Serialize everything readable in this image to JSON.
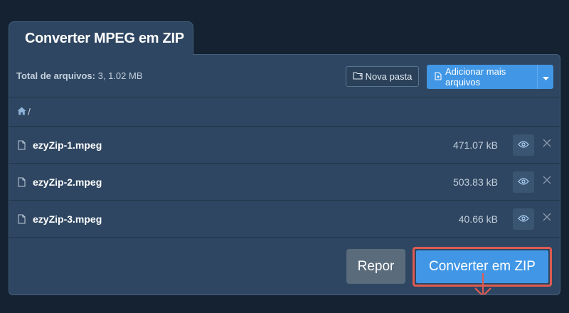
{
  "tab": {
    "title": "Converter MPEG em ZIP"
  },
  "toolbar": {
    "total_label": "Total de arquivos:",
    "total_value": "3, 1.02 MB",
    "new_folder_label": "Nova pasta",
    "add_files_label": "Adicionar mais arquivos"
  },
  "breadcrumb": {
    "root_separator": "/"
  },
  "files": [
    {
      "name": "ezyZip-1.mpeg",
      "size": "471.07 kB"
    },
    {
      "name": "ezyZip-2.mpeg",
      "size": "503.83 kB"
    },
    {
      "name": "ezyZip-3.mpeg",
      "size": "40.66 kB"
    }
  ],
  "actions": {
    "reset_label": "Repor",
    "convert_label": "Converter em ZIP"
  },
  "colors": {
    "background": "#152232",
    "panel": "#2e4661",
    "primary": "#4197e6",
    "reset": "#5a6b7b",
    "highlight": "#de5b52"
  },
  "icons": {
    "home": "home-icon",
    "file": "file-icon",
    "eye": "eye-icon",
    "close": "close-icon",
    "folder": "folder-icon",
    "add_file": "file-plus-icon",
    "caret": "caret-down-icon",
    "arrow": "arrow-down-icon"
  }
}
